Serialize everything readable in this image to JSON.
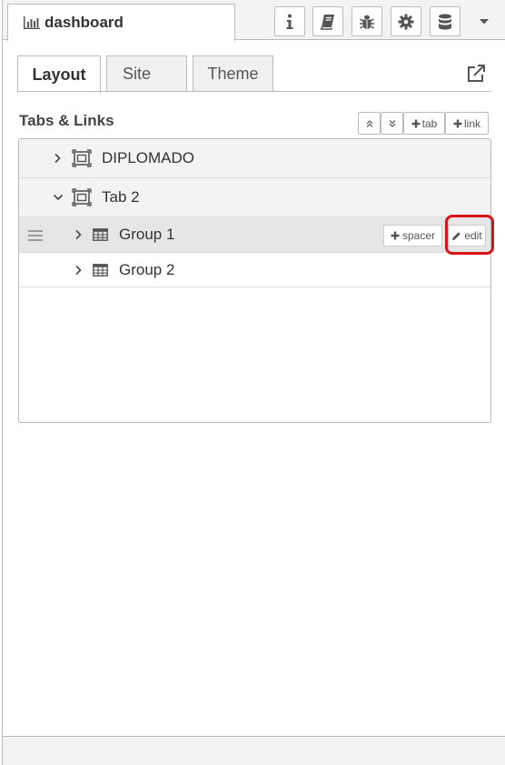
{
  "header": {
    "sidebar_tab_label": "dashboard",
    "icons": [
      "info-icon",
      "book-icon",
      "bug-icon",
      "gear-icon",
      "database-icon",
      "caret-down-icon"
    ]
  },
  "subtabs": [
    {
      "label": "Layout",
      "active": true
    },
    {
      "label": "Site",
      "active": false
    },
    {
      "label": "Theme",
      "active": false
    }
  ],
  "section": {
    "title": "Tabs & Links",
    "buttons": {
      "expand_all": "expand-all-icon",
      "collapse_all": "collapse-all-icon",
      "add_tab": "tab",
      "add_link": "link"
    }
  },
  "tree": {
    "tabs": [
      {
        "label": "DIPLOMADO",
        "expanded": false
      },
      {
        "label": "Tab 2",
        "expanded": true,
        "groups": [
          {
            "label": "Group 1",
            "highlighted": true,
            "spacer_label": "spacer",
            "edit_label": "edit"
          },
          {
            "label": "Group 2",
            "highlighted": false
          }
        ]
      }
    ]
  },
  "colors": {
    "highlight_outline": "#d6141c",
    "row_hover": "#e6e6e6",
    "header_bg": "#f3f3f3"
  }
}
